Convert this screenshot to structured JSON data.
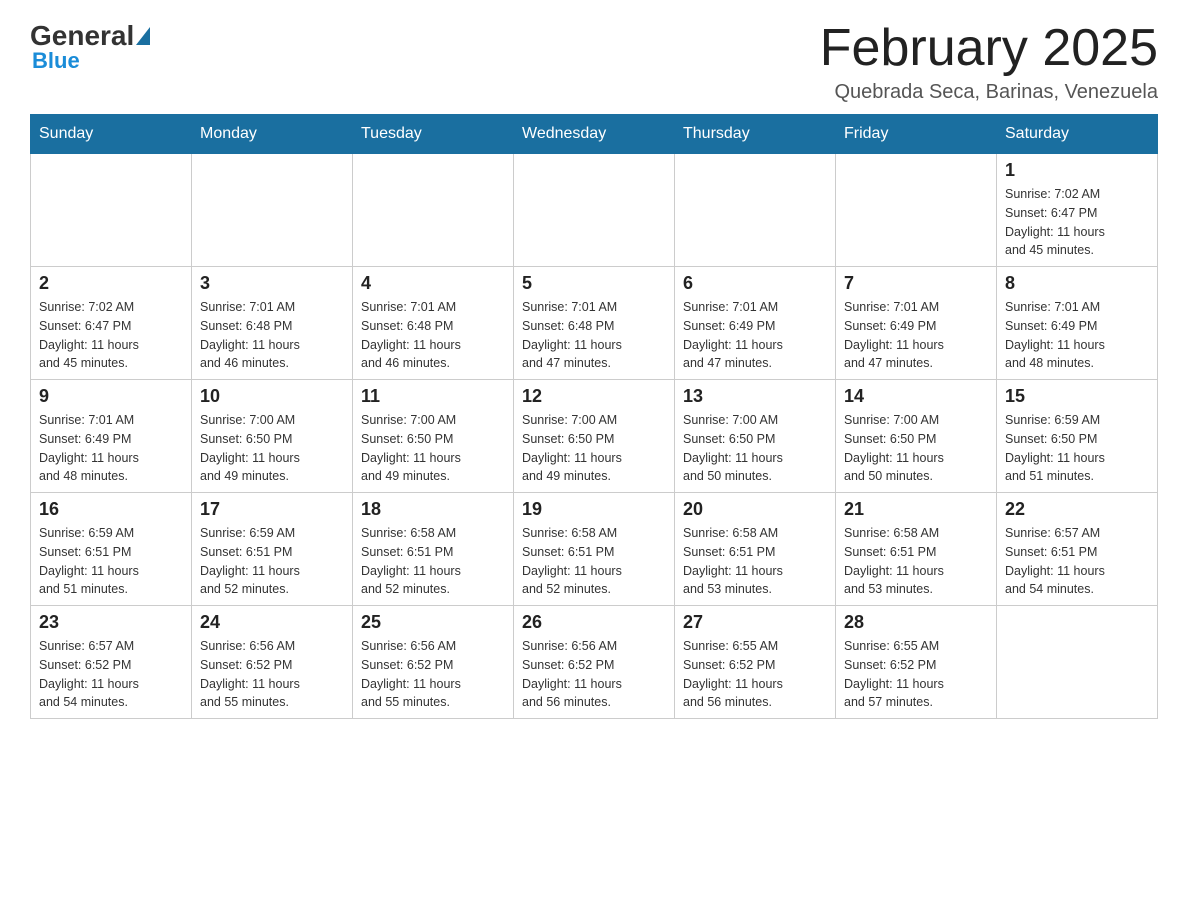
{
  "header": {
    "logo_general": "General",
    "logo_blue": "Blue",
    "month_title": "February 2025",
    "location": "Quebrada Seca, Barinas, Venezuela"
  },
  "days_of_week": [
    "Sunday",
    "Monday",
    "Tuesday",
    "Wednesday",
    "Thursday",
    "Friday",
    "Saturday"
  ],
  "weeks": [
    [
      {
        "day": "",
        "info": ""
      },
      {
        "day": "",
        "info": ""
      },
      {
        "day": "",
        "info": ""
      },
      {
        "day": "",
        "info": ""
      },
      {
        "day": "",
        "info": ""
      },
      {
        "day": "",
        "info": ""
      },
      {
        "day": "1",
        "info": "Sunrise: 7:02 AM\nSunset: 6:47 PM\nDaylight: 11 hours\nand 45 minutes."
      }
    ],
    [
      {
        "day": "2",
        "info": "Sunrise: 7:02 AM\nSunset: 6:47 PM\nDaylight: 11 hours\nand 45 minutes."
      },
      {
        "day": "3",
        "info": "Sunrise: 7:01 AM\nSunset: 6:48 PM\nDaylight: 11 hours\nand 46 minutes."
      },
      {
        "day": "4",
        "info": "Sunrise: 7:01 AM\nSunset: 6:48 PM\nDaylight: 11 hours\nand 46 minutes."
      },
      {
        "day": "5",
        "info": "Sunrise: 7:01 AM\nSunset: 6:48 PM\nDaylight: 11 hours\nand 47 minutes."
      },
      {
        "day": "6",
        "info": "Sunrise: 7:01 AM\nSunset: 6:49 PM\nDaylight: 11 hours\nand 47 minutes."
      },
      {
        "day": "7",
        "info": "Sunrise: 7:01 AM\nSunset: 6:49 PM\nDaylight: 11 hours\nand 47 minutes."
      },
      {
        "day": "8",
        "info": "Sunrise: 7:01 AM\nSunset: 6:49 PM\nDaylight: 11 hours\nand 48 minutes."
      }
    ],
    [
      {
        "day": "9",
        "info": "Sunrise: 7:01 AM\nSunset: 6:49 PM\nDaylight: 11 hours\nand 48 minutes."
      },
      {
        "day": "10",
        "info": "Sunrise: 7:00 AM\nSunset: 6:50 PM\nDaylight: 11 hours\nand 49 minutes."
      },
      {
        "day": "11",
        "info": "Sunrise: 7:00 AM\nSunset: 6:50 PM\nDaylight: 11 hours\nand 49 minutes."
      },
      {
        "day": "12",
        "info": "Sunrise: 7:00 AM\nSunset: 6:50 PM\nDaylight: 11 hours\nand 49 minutes."
      },
      {
        "day": "13",
        "info": "Sunrise: 7:00 AM\nSunset: 6:50 PM\nDaylight: 11 hours\nand 50 minutes."
      },
      {
        "day": "14",
        "info": "Sunrise: 7:00 AM\nSunset: 6:50 PM\nDaylight: 11 hours\nand 50 minutes."
      },
      {
        "day": "15",
        "info": "Sunrise: 6:59 AM\nSunset: 6:50 PM\nDaylight: 11 hours\nand 51 minutes."
      }
    ],
    [
      {
        "day": "16",
        "info": "Sunrise: 6:59 AM\nSunset: 6:51 PM\nDaylight: 11 hours\nand 51 minutes."
      },
      {
        "day": "17",
        "info": "Sunrise: 6:59 AM\nSunset: 6:51 PM\nDaylight: 11 hours\nand 52 minutes."
      },
      {
        "day": "18",
        "info": "Sunrise: 6:58 AM\nSunset: 6:51 PM\nDaylight: 11 hours\nand 52 minutes."
      },
      {
        "day": "19",
        "info": "Sunrise: 6:58 AM\nSunset: 6:51 PM\nDaylight: 11 hours\nand 52 minutes."
      },
      {
        "day": "20",
        "info": "Sunrise: 6:58 AM\nSunset: 6:51 PM\nDaylight: 11 hours\nand 53 minutes."
      },
      {
        "day": "21",
        "info": "Sunrise: 6:58 AM\nSunset: 6:51 PM\nDaylight: 11 hours\nand 53 minutes."
      },
      {
        "day": "22",
        "info": "Sunrise: 6:57 AM\nSunset: 6:51 PM\nDaylight: 11 hours\nand 54 minutes."
      }
    ],
    [
      {
        "day": "23",
        "info": "Sunrise: 6:57 AM\nSunset: 6:52 PM\nDaylight: 11 hours\nand 54 minutes."
      },
      {
        "day": "24",
        "info": "Sunrise: 6:56 AM\nSunset: 6:52 PM\nDaylight: 11 hours\nand 55 minutes."
      },
      {
        "day": "25",
        "info": "Sunrise: 6:56 AM\nSunset: 6:52 PM\nDaylight: 11 hours\nand 55 minutes."
      },
      {
        "day": "26",
        "info": "Sunrise: 6:56 AM\nSunset: 6:52 PM\nDaylight: 11 hours\nand 56 minutes."
      },
      {
        "day": "27",
        "info": "Sunrise: 6:55 AM\nSunset: 6:52 PM\nDaylight: 11 hours\nand 56 minutes."
      },
      {
        "day": "28",
        "info": "Sunrise: 6:55 AM\nSunset: 6:52 PM\nDaylight: 11 hours\nand 57 minutes."
      },
      {
        "day": "",
        "info": ""
      }
    ]
  ]
}
